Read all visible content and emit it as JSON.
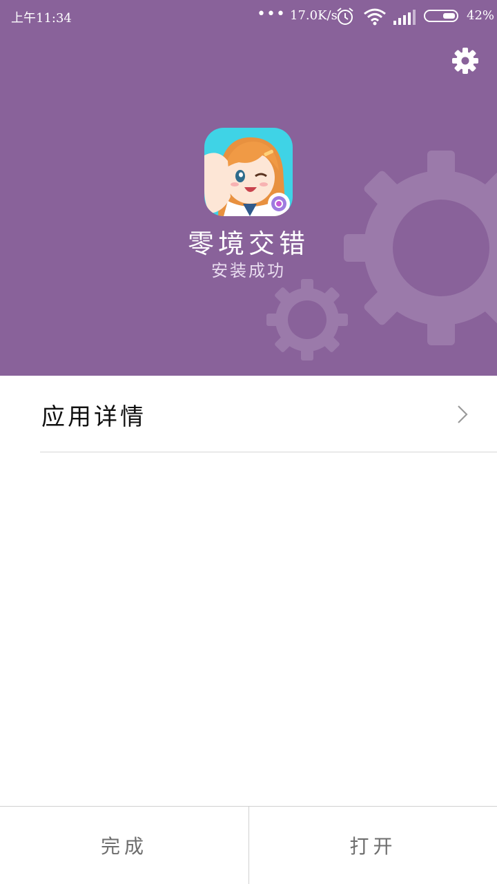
{
  "status_bar": {
    "time": "上午11:34",
    "dots": "•••",
    "net_speed": "17.0K/s",
    "battery_percent": "42%",
    "battery_level": 0.42
  },
  "header": {
    "background_color": "#89629a",
    "settings_icon": "gear-icon",
    "app_name": "零境交错",
    "install_status": "安装成功"
  },
  "details": {
    "label": "应用详情",
    "chevron_icon": "chevron-right-icon"
  },
  "bottom_bar": {
    "done_label": "完成",
    "open_label": "打开"
  }
}
